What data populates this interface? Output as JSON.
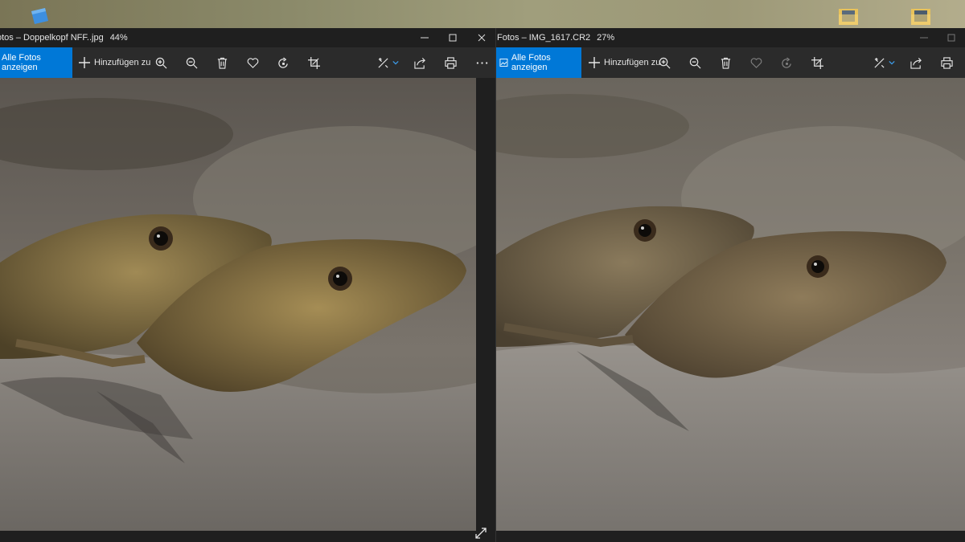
{
  "colors": {
    "accent": "#0078d7",
    "window_bg": "#1f1f1f",
    "toolbar_bg": "#2b2b2b",
    "text": "#e6e6e6"
  },
  "left_window": {
    "title": "otos – Doppelkopf NFF..jpg",
    "zoom": "44%",
    "all_photos_label": "Alle Fotos anzeigen",
    "add_label": "Hinzufügen zu",
    "icons": [
      "zoom-in-icon",
      "zoom-out-icon",
      "delete-icon",
      "favorite-icon",
      "rotate-icon",
      "crop-icon",
      "edit-icon",
      "share-icon",
      "print-icon",
      "more-icon"
    ]
  },
  "right_window": {
    "title": "Fotos – IMG_1617.CR2",
    "zoom": "27%",
    "all_photos_label": "Alle Fotos anzeigen",
    "add_label": "Hinzufügen zu",
    "icons": [
      "zoom-in-icon",
      "zoom-out-icon",
      "delete-icon",
      "favorite-icon",
      "rotate-icon",
      "crop-icon",
      "edit-icon",
      "share-icon",
      "print-icon"
    ]
  }
}
